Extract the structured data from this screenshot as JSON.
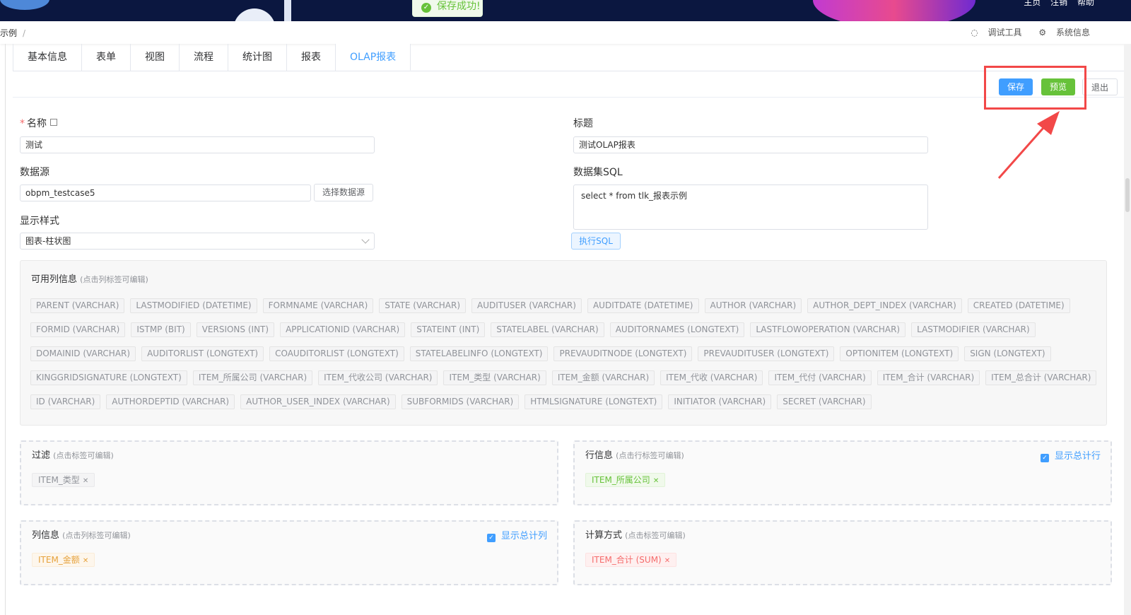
{
  "topbar": {
    "links": [
      "主页",
      "注销",
      "帮助"
    ]
  },
  "toast": {
    "message": "保存成功!"
  },
  "breadcrumb": {
    "current": "示例",
    "separator": "/"
  },
  "tools": {
    "debug": "调试工具",
    "sysinfo": "系统信息"
  },
  "tabs": [
    "基本信息",
    "表单",
    "视图",
    "流程",
    "统计图",
    "报表",
    "OLAP报表"
  ],
  "active_tab": "OLAP报表",
  "actions": {
    "save": "保存",
    "preview": "预览",
    "exit": "退出"
  },
  "form": {
    "name_label": "名称",
    "name_value": "测试",
    "title_label": "标题",
    "title_value": "测试OLAP报表",
    "datasource_label": "数据源",
    "datasource_value": "obpm_testcase5",
    "select_datasource": "选择数据源",
    "sql_label": "数据集SQL",
    "sql_value": "select * from tlk_报表示例",
    "run_sql": "执行SQL",
    "style_label": "显示样式",
    "style_value": "图表-柱状图"
  },
  "available": {
    "title": "可用列信息",
    "hint": "(点击列标签可编辑)",
    "rows": [
      [
        "PARENT (VARCHAR)",
        "LASTMODIFIED (DATETIME)",
        "FORMNAME (VARCHAR)",
        "STATE (VARCHAR)",
        "AUDITUSER (VARCHAR)",
        "AUDITDATE (DATETIME)",
        "AUTHOR (VARCHAR)",
        "AUTHOR_DEPT_INDEX (VARCHAR)",
        "CREATED (DATETIME)"
      ],
      [
        "FORMID (VARCHAR)",
        "ISTMP (BIT)",
        "VERSIONS (INT)",
        "APPLICATIONID (VARCHAR)",
        "STATEINT (INT)",
        "STATELABEL (VARCHAR)",
        "AUDITORNAMES (LONGTEXT)",
        "LASTFLOWOPERATION (VARCHAR)",
        "LASTMODIFIER (VARCHAR)"
      ],
      [
        "DOMAINID (VARCHAR)",
        "AUDITORLIST (LONGTEXT)",
        "COAUDITORLIST (LONGTEXT)",
        "STATELABELINFO (LONGTEXT)",
        "PREVAUDITNODE (LONGTEXT)",
        "PREVAUDITUSER (LONGTEXT)",
        "OPTIONITEM (LONGTEXT)",
        "SIGN (LONGTEXT)"
      ],
      [
        "KINGGRIDSIGNATURE (LONGTEXT)",
        "ITEM_所属公司 (VARCHAR)",
        "ITEM_代收公司 (VARCHAR)",
        "ITEM_类型 (VARCHAR)",
        "ITEM_金额 (VARCHAR)",
        "ITEM_代收 (VARCHAR)",
        "ITEM_代付 (VARCHAR)",
        "ITEM_合计 (VARCHAR)",
        "ITEM_总合计 (VARCHAR)"
      ],
      [
        "ID (VARCHAR)",
        "AUTHORDEPTID (VARCHAR)",
        "AUTHOR_USER_INDEX (VARCHAR)",
        "SUBFORMIDS (VARCHAR)",
        "HTMLSIGNATURE (LONGTEXT)",
        "INITIATOR (VARCHAR)",
        "SECRET (VARCHAR)"
      ]
    ]
  },
  "filter": {
    "title": "过滤",
    "hint": "(点击标签可编辑)",
    "tag": "ITEM_类型"
  },
  "rowinfo": {
    "title": "行信息",
    "hint": "(点击行标签可编辑)",
    "tag": "ITEM_所属公司",
    "check_label": "显示总计行"
  },
  "colinfo": {
    "title": "列信息",
    "hint": "(点击列标签可编辑)",
    "tag": "ITEM_金额",
    "check_label": "显示总计列"
  },
  "calc": {
    "title": "计算方式",
    "hint": "(点击标签可编辑)",
    "tag": "ITEM_合计 (SUM)"
  }
}
